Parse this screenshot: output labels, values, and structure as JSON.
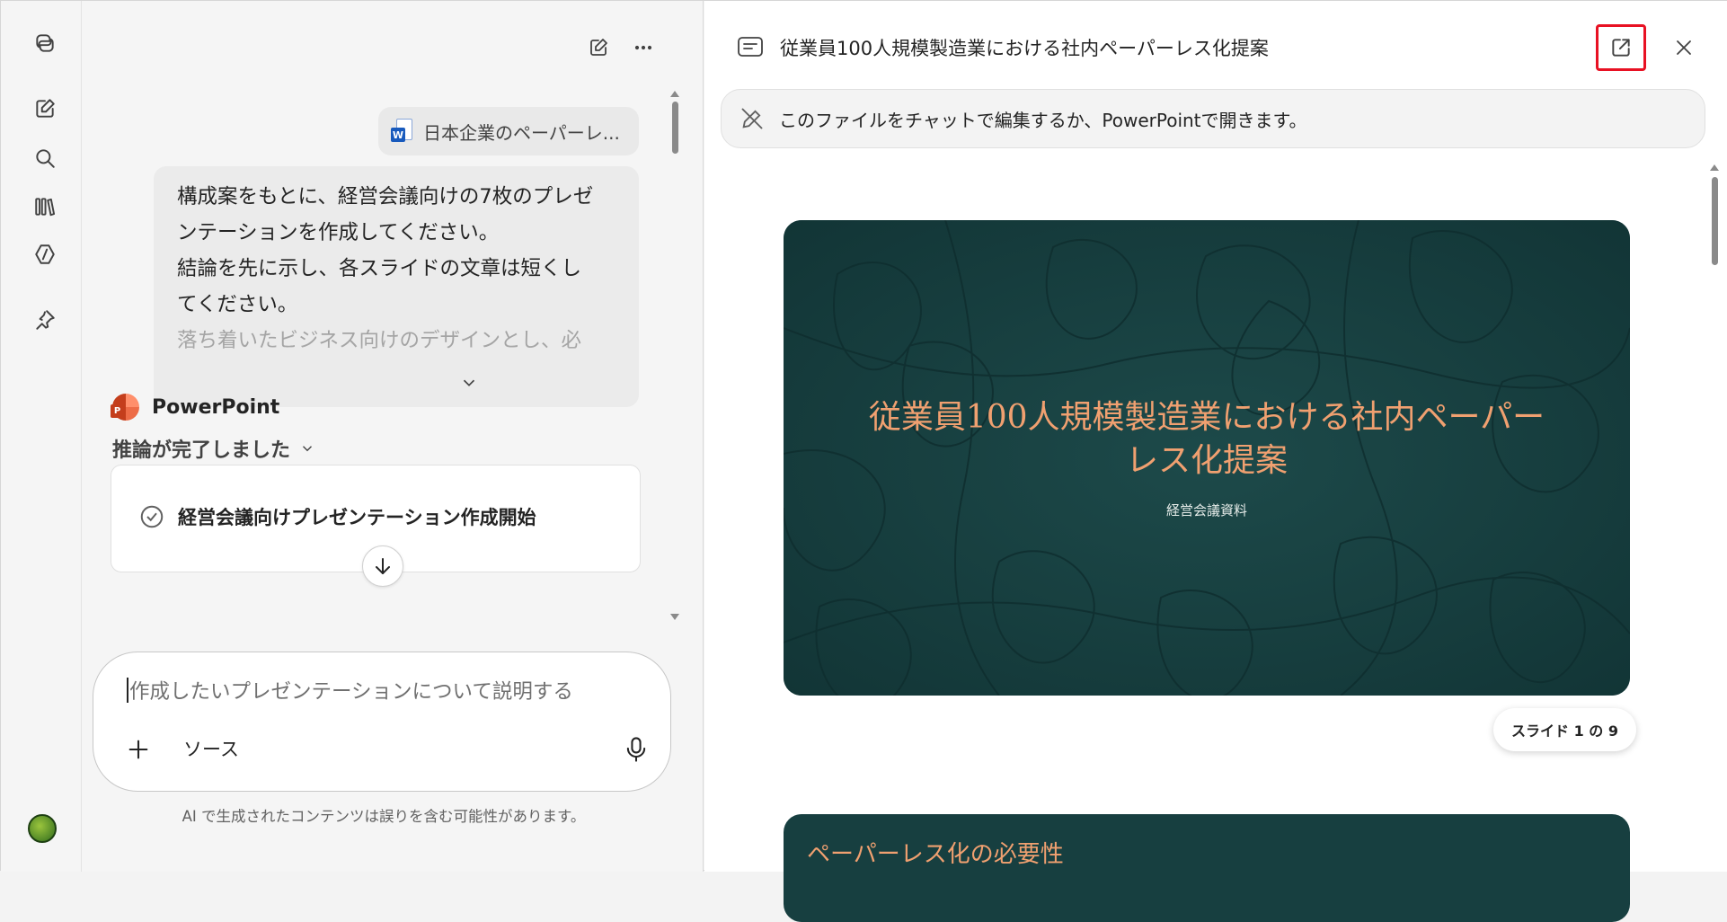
{
  "chat": {
    "attachment_label": "日本企業のペーパーレ...",
    "user_message_lines": [
      "構成案をもとに、経営会議向けの7枚のプレゼ",
      "ンテーションを作成してください。",
      "結論を先に示し、各スライドの文章は短くし",
      "てください。",
      "落ち着いたビジネス向けのデザインとし、必"
    ],
    "app_name": "PowerPoint",
    "reasoning_label": "推論が完了しました",
    "step_label": "経営会議向けプレゼンテーション作成開始",
    "composer_placeholder": "作成したいプレゼンテーションについて説明する",
    "source_label": "ソース",
    "disclaimer": "AI で生成されたコンテンツは誤りを含む可能性があります。"
  },
  "preview": {
    "doc_title": "従業員100人規模製造業における社内ペーパーレス化提案",
    "notice": "このファイルをチャットで編集するか、PowerPointで開きます。",
    "slide1_title_line1": "従業員100人規模製造業における社内ペーパー",
    "slide1_title_line2": "レス化提案",
    "slide1_subtitle": "経営会議資料",
    "slide_counter": "スライド 1 の 9",
    "slide2_title": "ペーパーレス化の必要性"
  },
  "colors": {
    "slide_background": "#173f40",
    "slide_title": "#f0a070",
    "highlight_border": "#e81123"
  },
  "icons": {
    "rail": [
      "copilot-logo-icon",
      "new-chat-icon",
      "search-icon",
      "library-icon",
      "create-icon",
      "pin-icon"
    ],
    "chat_header": [
      "compose-icon",
      "more-icon"
    ],
    "preview_header": [
      "document-icon",
      "open-in-app-icon",
      "close-icon"
    ]
  }
}
